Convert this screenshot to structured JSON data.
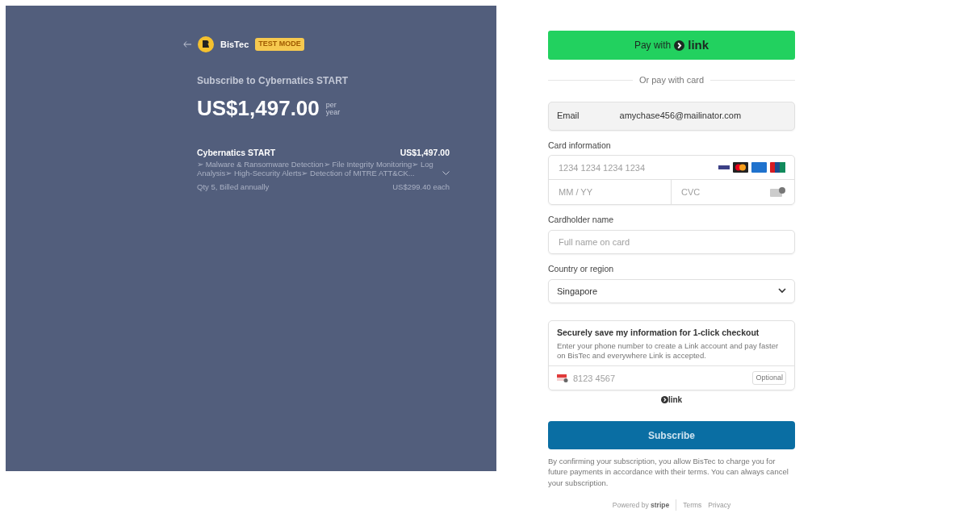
{
  "summary": {
    "brand": "BisTec",
    "mode_badge": "TEST MODE",
    "heading": "Subscribe to Cybernatics START",
    "price": "US$1,497.00",
    "period_top": "per",
    "period_bottom": "year",
    "item": {
      "name": "Cybernatics START",
      "amount": "US$1,497.00",
      "description": "➢ Malware & Ransomware Detection➢ File Integrity Monitoring➢ Log Analysis➢ High-Security Alerts➢ Detection of MITRE ATT&CK...",
      "quantity": "Qty 5, Billed annually",
      "unit_price": "US$299.40 each"
    }
  },
  "payment": {
    "link_button": {
      "label": "Pay with",
      "logo": "link"
    },
    "divider": "Or pay with card",
    "email": {
      "label": "Email",
      "value": "amychase456@mailinator.com"
    },
    "card": {
      "label": "Card information",
      "number_placeholder": "1234 1234 1234 1234",
      "expiry_placeholder": "MM / YY",
      "cvc_placeholder": "CVC"
    },
    "cardholder": {
      "label": "Cardholder name",
      "placeholder": "Full name on card"
    },
    "country": {
      "label": "Country or region",
      "value": "Singapore"
    },
    "save": {
      "title": "Securely save my information for 1-click checkout",
      "text": "Enter your phone number to create a Link account and pay faster on BisTec and everywhere Link is accepted.",
      "phone_placeholder": "8123 4567",
      "optional": "Optional",
      "link_logo": "link"
    },
    "submit": "Subscribe",
    "terms": "By confirming your subscription, you allow BisTec to charge you for future payments in accordance with their terms. You can always cancel your subscription.",
    "footer": {
      "powered": "Powered by",
      "stripe": "stripe",
      "links": [
        "Terms",
        "Privacy"
      ]
    }
  }
}
